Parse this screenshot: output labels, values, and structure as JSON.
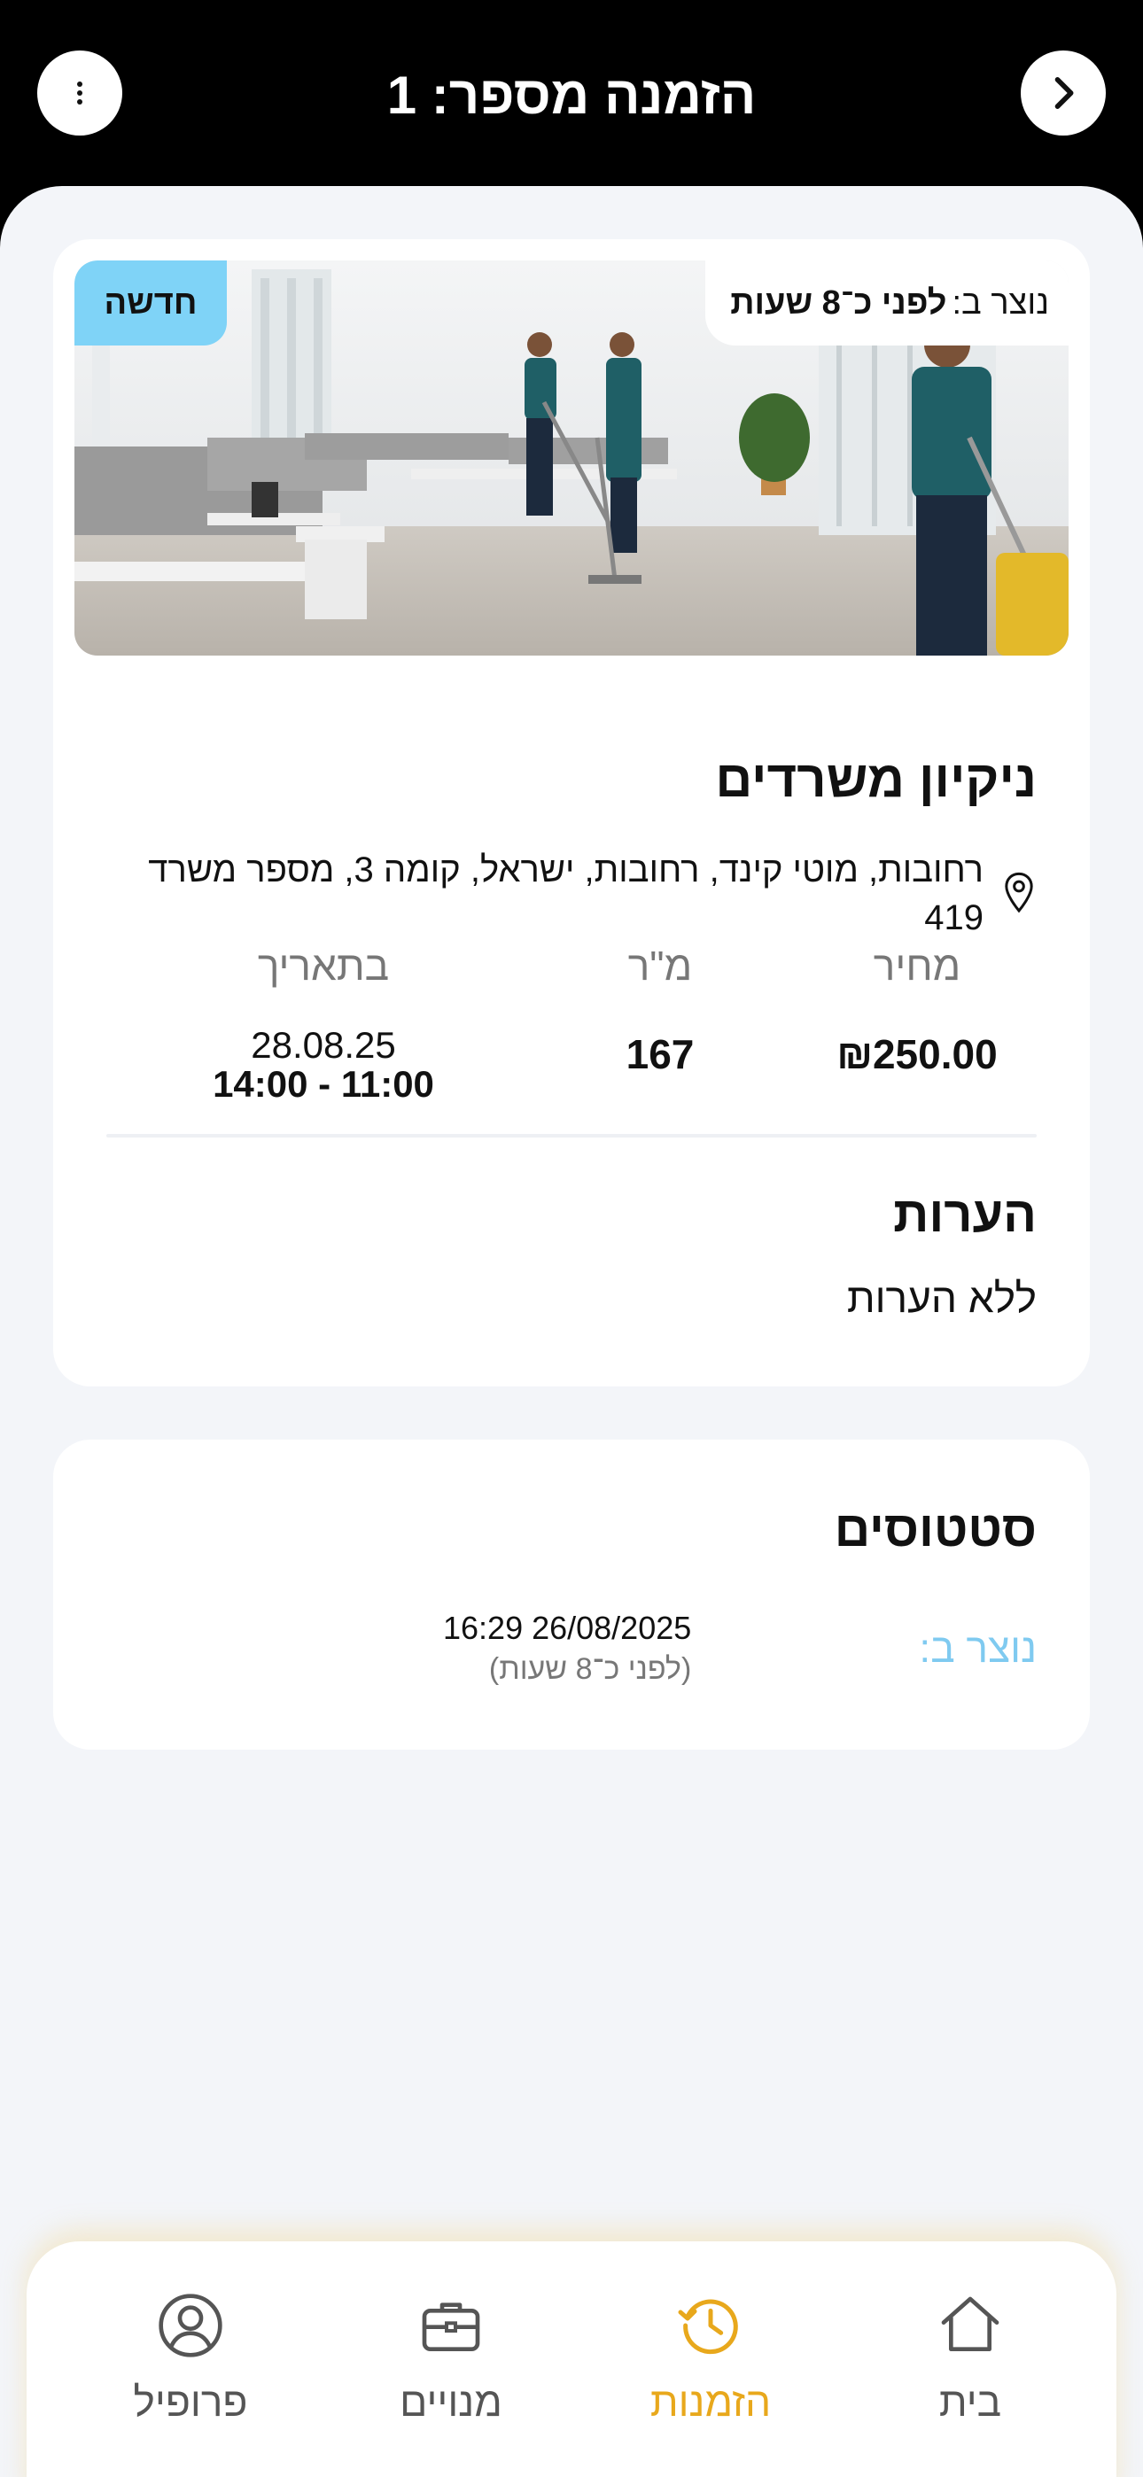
{
  "header": {
    "title": "הזמנה מספר: 1",
    "back_icon": "chevron-right-icon",
    "menu_icon": "more-vertical-icon"
  },
  "order": {
    "badge": "חדשה",
    "created_label": "נוצר ב:",
    "created_relative": "לפני כ־8 שעות",
    "title": "ניקיון משרדים",
    "address": "רחובות, מוטי קינד, רחובות, ישראל, קומה 3, מספר משרד 419",
    "price_label": "מחיר",
    "price_value": "₪250.00",
    "sqm_label": "מ\"ר",
    "sqm_value": "167",
    "date_label": "בתאריך",
    "date_value": "28.08.25",
    "time_value": "11:00 - 14:00",
    "notes_title": "הערות",
    "notes_value": "ללא הערות"
  },
  "statuses": {
    "title": "סטטוסים",
    "created_label": "נוצר ב:",
    "created_datetime": "16:29 26/08/2025",
    "created_relative": "(לפני כ־8 שעות)"
  },
  "nav": {
    "items": [
      {
        "label": "בית",
        "icon": "home-icon",
        "active": false
      },
      {
        "label": "הזמנות",
        "icon": "history-clock-icon",
        "active": true
      },
      {
        "label": "מנויים",
        "icon": "briefcase-icon",
        "active": false
      },
      {
        "label": "פרופיל",
        "icon": "user-icon",
        "active": false
      }
    ]
  },
  "colors": {
    "accent": "#e8a81c",
    "badge": "#7fd3f7",
    "status_label": "#7fcaf0",
    "background": "#f3f5f9",
    "header": "#000000"
  }
}
